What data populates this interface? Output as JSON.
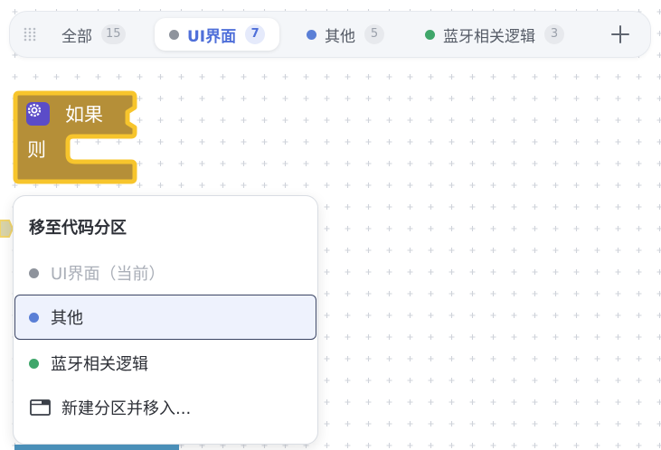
{
  "tabs": [
    {
      "label": "全部",
      "count": "15",
      "color": "",
      "active": false
    },
    {
      "label": "UI界面",
      "count": "7",
      "color": "#8e939c",
      "active": true
    },
    {
      "label": "其他",
      "count": "5",
      "color": "#5a7fd6",
      "active": false
    },
    {
      "label": "蓝牙相关逻辑",
      "count": "3",
      "color": "#3fa66a",
      "active": false
    }
  ],
  "add_tab_icon": "plus-icon",
  "drag_handle_icon": "grip-icon",
  "block": {
    "if_label": "如果",
    "then_label": "则",
    "color": "#b58f38",
    "outline": "#f7c52c",
    "icon": "gear-icon"
  },
  "context_menu": {
    "title": "移至代码分区",
    "items": [
      {
        "label": "UI界面（当前）",
        "color": "#8e939c",
        "disabled": true
      },
      {
        "label": "其他",
        "color": "#5a7fd6",
        "disabled": false,
        "highlighted": true
      },
      {
        "label": "蓝牙相关逻辑",
        "color": "#3fa66a",
        "disabled": false
      }
    ],
    "new_section_label": "新建分区并移入...",
    "new_section_icon": "new-window-icon"
  }
}
